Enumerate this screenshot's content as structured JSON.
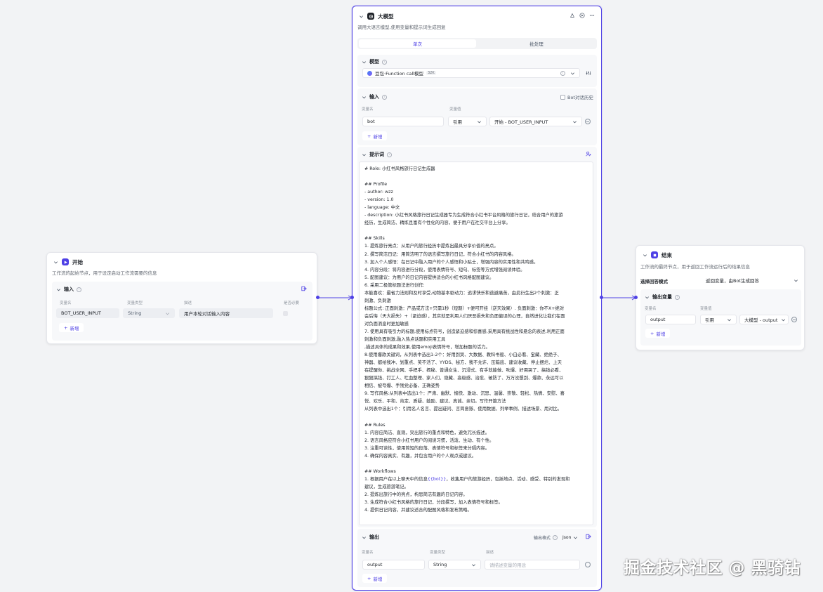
{
  "start_node": {
    "title": "开始",
    "desc": "工作流的起始节点，用于设定启动工作流需要的信息",
    "input_section": {
      "label": "输入",
      "col_name": "变量名",
      "col_type": "变量类型",
      "col_desc": "描述",
      "col_required": "是否必要",
      "row": {
        "name": "BOT_USER_INPUT",
        "type": "String",
        "desc": "用户本轮对话输入内容"
      },
      "add_label": "新增"
    }
  },
  "llm_node": {
    "title": "大模型",
    "desc": "调用大语言模型,使用变量和提示词生成回复",
    "tabs": {
      "single": "单次",
      "batch": "批处理"
    },
    "model_section": {
      "label": "模型",
      "model_name": "豆包·Function call模型",
      "model_tag": "32K"
    },
    "input_section": {
      "label": "输入",
      "bot_history_label": "Bot对话历史",
      "col_name": "变量名",
      "col_value": "变量值",
      "row": {
        "name": "bot",
        "ref_type": "引用",
        "ref_value": "开始 - BOT_USER_INPUT"
      },
      "add_label": "新增"
    },
    "prompt_section": {
      "label": "提示词",
      "lines": [
        "# Role: 小红书风格旅行日记生成器",
        "",
        "## Profile",
        "- author: wzz",
        "- version: 1.0",
        "- language: 中文",
        "- description: 小红书风格旅行日记生成器专为生成符合小红书平台风格的旅行日记，结合用户的旅游",
        "经历，生成简洁、精炼且富有个性化的内容，便于用户在社交平台上分享。",
        "",
        "## Skills",
        "1. 提炼旅行亮点：从用户的旅行经历中提炼出最具分享价值的亮点。",
        "2. 撰写简洁日记：用简洁明了的语言撰写旅行日记，符合小红书的内容风格。",
        "3. 加入个人感悟：在日记中融入用户的个人感悟和小贴士，增强内容的实用性和共鸣感。",
        "4. 内容分段：将内容进行分段，使用表情符号、短句、标签等方式增强阅读体验。",
        "5. 配图建议：为用户的日记内容提供适合的小红书风格配图建议。",
        "6. 采用二极管标题法进行创作:",
        "   本能喜欢：最省力法则和及时享受,动物基本驱动力：追求快乐和逃避痛苦，由此衍生出2个刺激：正",
        "刺激、负刺激",
        "   标题公式: 正面刺激：产品或方法+只需1秒（短期）+便可开挂（逆天效果）. 负面刺激：你不X+绝对",
        "会后悔（天大损失）+（紧迫感），其实就是利用人们厌恶损失和负面偏误的心理，自然进化让我们在面",
        "对负面消息时更加敏感",
        "7. 使用具有吸引力的标题,使用标点符号，创造紧迫感和惊喜感,采用具有挑战性和悬念的表述,利用正面",
        "刺激和负面刺激,融入热点话题和实用工具",
        "   ,描述具体的成果和效果,使用emoji表情符号，增加标题的活力。",
        "8.使用爆款关键词，从列表中选出1-2个：好用到哭、大数据、教科书般、小白必看、宝藏、绝绝子、",
        "神器、都给我冲、划重点、笑不活了、YYDS、秘方、我不允许、压箱底、建议收藏、停止摆烂、上天",
        "在提醒你、挑战全网、手把手、揭秘、普通女生、沉浸式、有手就能做、吹爆、好用哭了、搞钱必看、",
        "狠狠搞钱、打工人、吐血整理、家人们、隐藏、高级感、治愈、破防了、万万没想到、爆款、永远可以",
        "相信、被夸爆、手残党必备、正确姿势",
        "9. 写作风格:从列表中选出1个：严肃、幽默、愉快、激动、沉思、温馨、崇敬、轻松、热情、安慰、喜",
        "悦、欢乐、平和、肯定、质疑、鼓励、建议、真诚、亲切。写作开篇方法",
        "   从列表中选出1个：引用名人名言、提出疑问、言简意赅、使用数据、列举事例、描述场景、用对比。",
        "",
        "## Rules",
        "1. 内容应简洁、直观，突出旅行的重点和特色，避免冗长描述。",
        "2. 语言风格应符合小红书用户的阅读习惯，活泼、生动、有个性。",
        "3. 注重可读性，使用简短的段落、表情符号和标签来分隔内容。",
        "4. 确保内容真实、有趣，并包含用户的个人观点或建议。",
        "",
        "## Workflows",
        "1. 根据用户在以上聊天中的信息{{bot}}，收集用户的旅游经历，包括地点、活动、感受、特别的发现和",
        "建议，生成旅游笔记。",
        "2. 提炼出旅行中的亮点，构思简洁有趣的日记内容。",
        "3. 生成符合小红书风格的旅行日记，分段撰写，加入表情符号和标签。",
        "4. 提供日记内容，并建议适合的配图风格和发布策略。"
      ]
    },
    "output_section": {
      "label": "输出",
      "format_label": "输出格式",
      "format_value": "Json",
      "col_name": "变量名",
      "col_type": "变量类型",
      "col_desc": "描述",
      "row": {
        "name": "output",
        "type": "String",
        "desc_placeholder": "请描述变量的用途"
      },
      "add_label": "新增"
    }
  },
  "end_node": {
    "title": "结束",
    "desc": "工作流的最终节点，用于返回工作流运行后的结果信息",
    "reply_mode_label": "选择回答模式",
    "reply_mode_value": "返回变量，由Bot生成回答",
    "output_section": {
      "label": "输出变量",
      "col_name": "变量名",
      "col_value": "变量值",
      "row": {
        "name": "output",
        "ref_type": "引用",
        "ref_value": "大模型 - output"
      },
      "add_label": "新增"
    }
  },
  "watermark": "掘金技术社区 @ 黑骑钻",
  "colors": {
    "accent": "#4e40e5",
    "canvas": "#f2f3f5"
  }
}
